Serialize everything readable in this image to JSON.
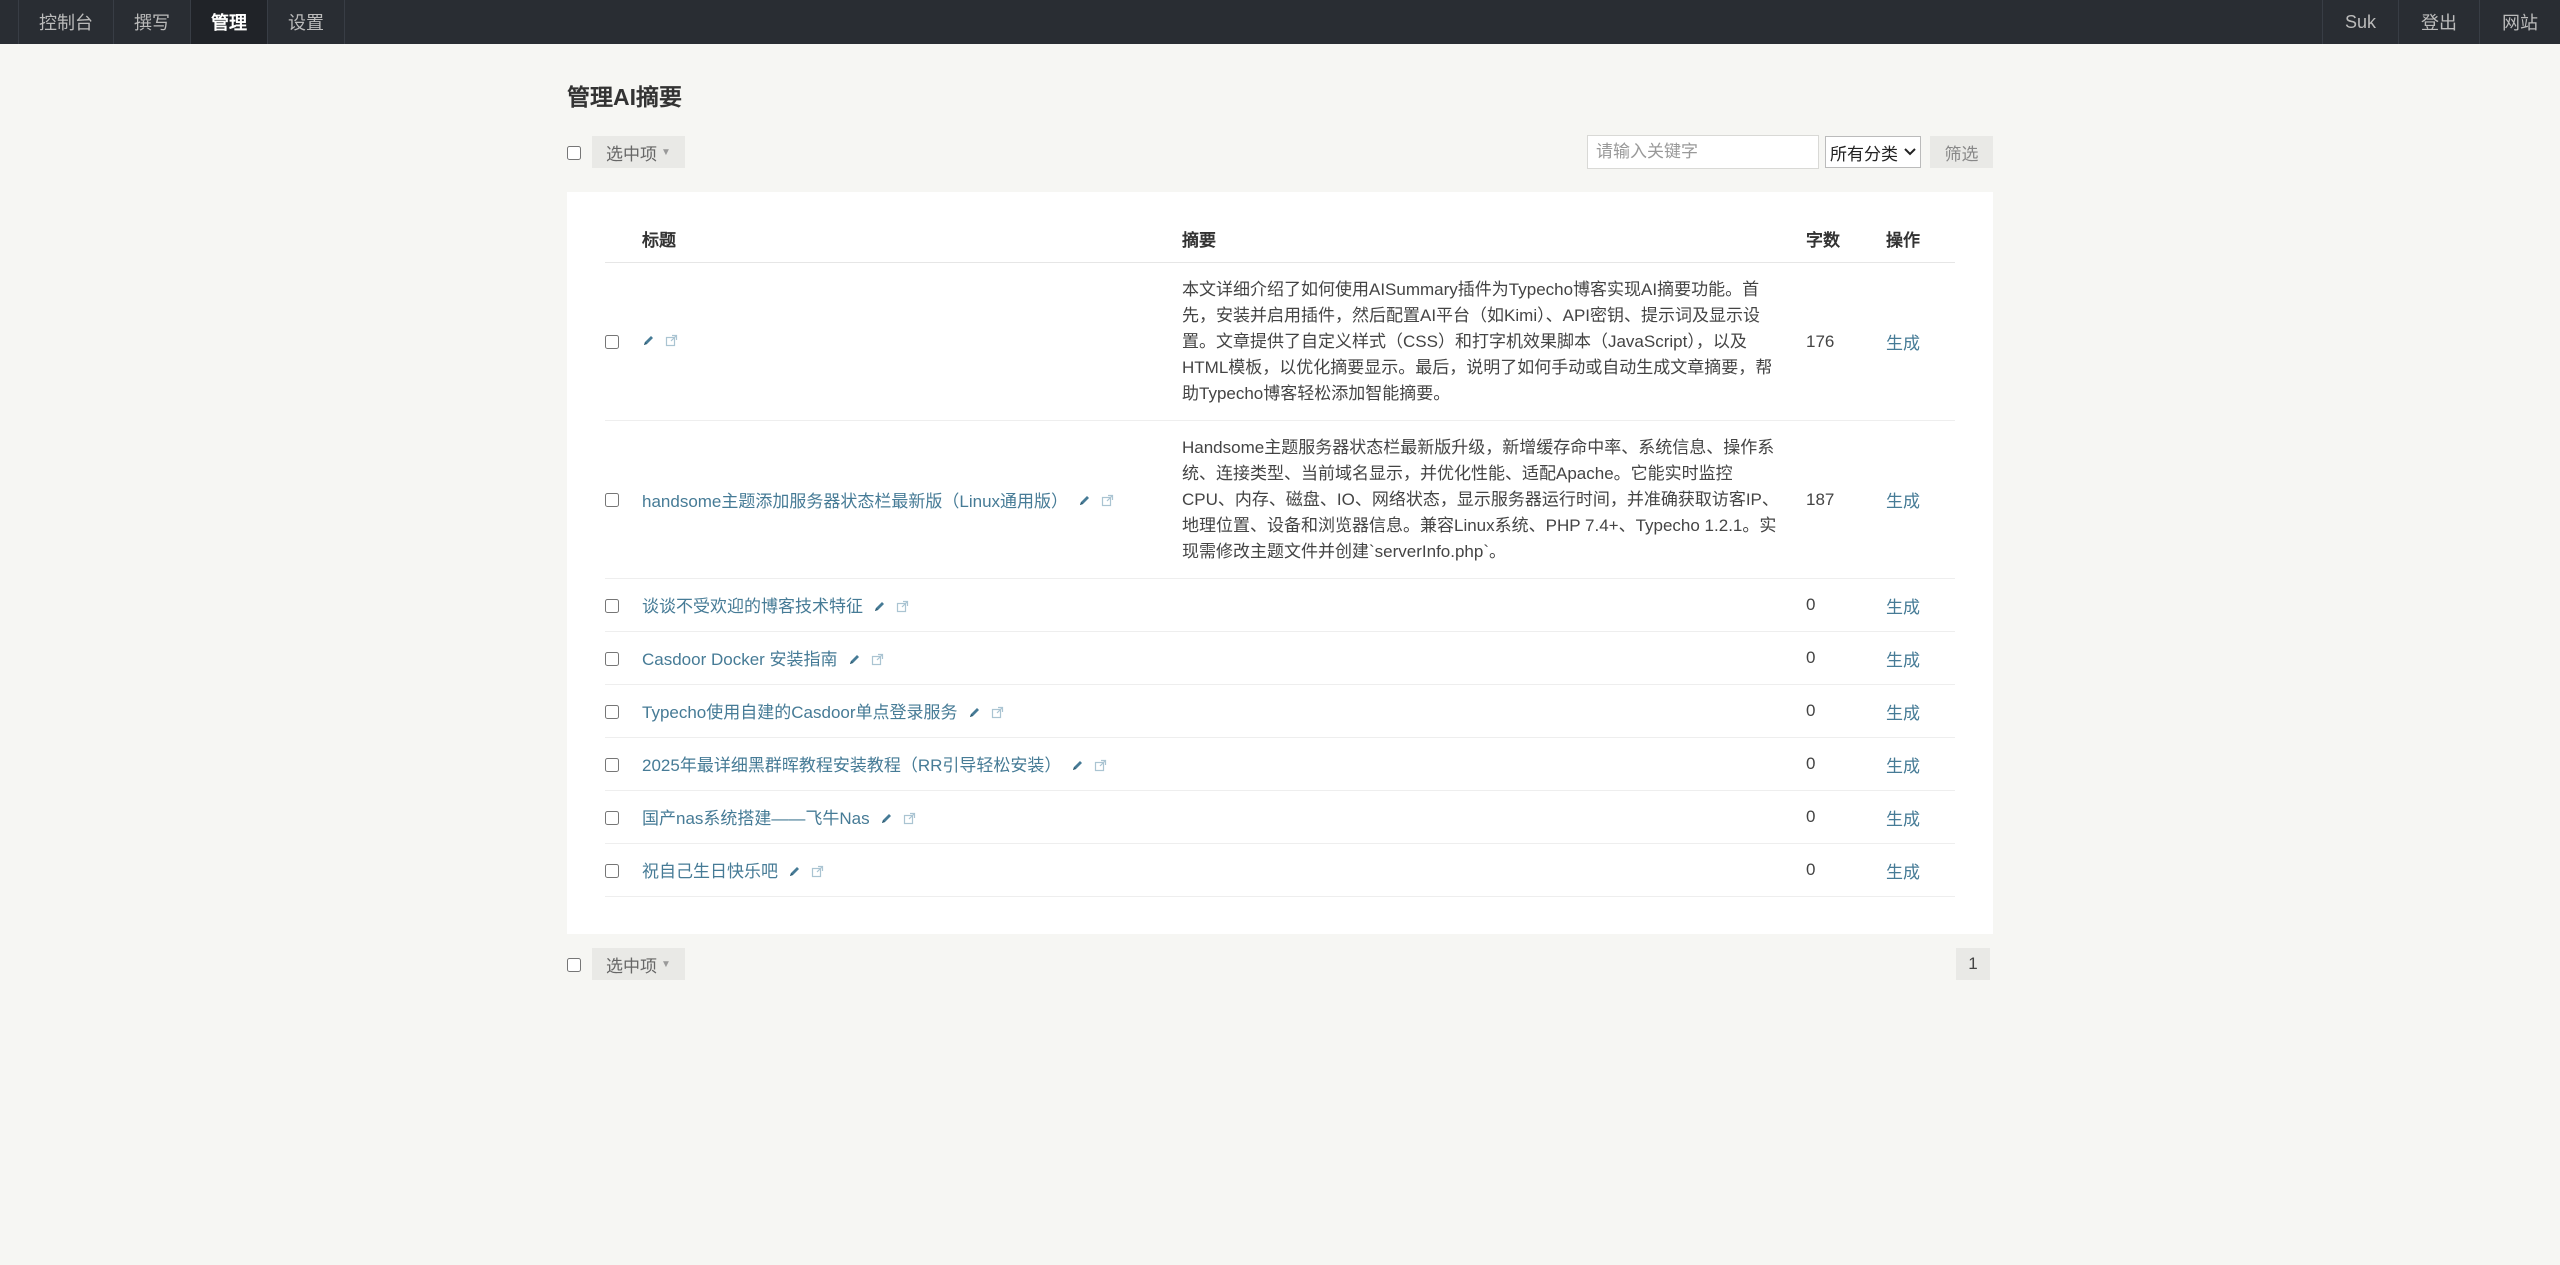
{
  "nav": {
    "left": [
      "控制台",
      "撰写",
      "管理",
      "设置"
    ],
    "active": "管理",
    "right": [
      "Suk",
      "登出",
      "网站"
    ]
  },
  "page": {
    "title": "管理AI摘要"
  },
  "toolbar": {
    "select_label": "选中项",
    "search_placeholder": "请输入关键字",
    "category_selected": "所有分类",
    "filter_label": "筛选"
  },
  "table": {
    "headers": {
      "title": "标题",
      "summary": "摘要",
      "count": "字数",
      "action": "操作"
    },
    "rows": [
      {
        "title": "",
        "summary": "本文详细介绍了如何使用AISummary插件为Typecho博客实现AI摘要功能。首先，安装并启用插件，然后配置AI平台（如Kimi）、API密钥、提示词及显示设置。文章提供了自定义样式（CSS）和打字机效果脚本（JavaScript），以及HTML模板，以优化摘要显示。最后，说明了如何手动或自动生成文章摘要，帮助Typecho博客轻松添加智能摘要。",
        "count": "176",
        "action": "生成"
      },
      {
        "title": "handsome主题添加服务器状态栏最新版（Linux通用版）",
        "summary": "Handsome主题服务器状态栏最新版升级，新增缓存命中率、系统信息、操作系统、连接类型、当前域名显示，并优化性能、适配Apache。它能实时监控CPU、内存、磁盘、IO、网络状态，显示服务器运行时间，并准确获取访客IP、地理位置、设备和浏览器信息。兼容Linux系统、PHP 7.4+、Typecho 1.2.1。实现需修改主题文件并创建`serverInfo.php`。",
        "count": "187",
        "action": "生成"
      },
      {
        "title": "谈谈不受欢迎的博客技术特征",
        "summary": "",
        "count": "0",
        "action": "生成"
      },
      {
        "title": "Casdoor Docker 安装指南",
        "summary": "",
        "count": "0",
        "action": "生成"
      },
      {
        "title": "Typecho使用自建的Casdoor单点登录服务",
        "summary": "",
        "count": "0",
        "action": "生成"
      },
      {
        "title": "2025年最详细黑群晖教程安装教程（RR引导轻松安装）",
        "summary": "",
        "count": "0",
        "action": "生成"
      },
      {
        "title": "国产nas系统搭建——飞牛Nas",
        "summary": "",
        "count": "0",
        "action": "生成"
      },
      {
        "title": "祝自己生日快乐吧",
        "summary": "",
        "count": "0",
        "action": "生成"
      }
    ]
  },
  "bottom": {
    "select_label": "选中项",
    "page": "1"
  }
}
